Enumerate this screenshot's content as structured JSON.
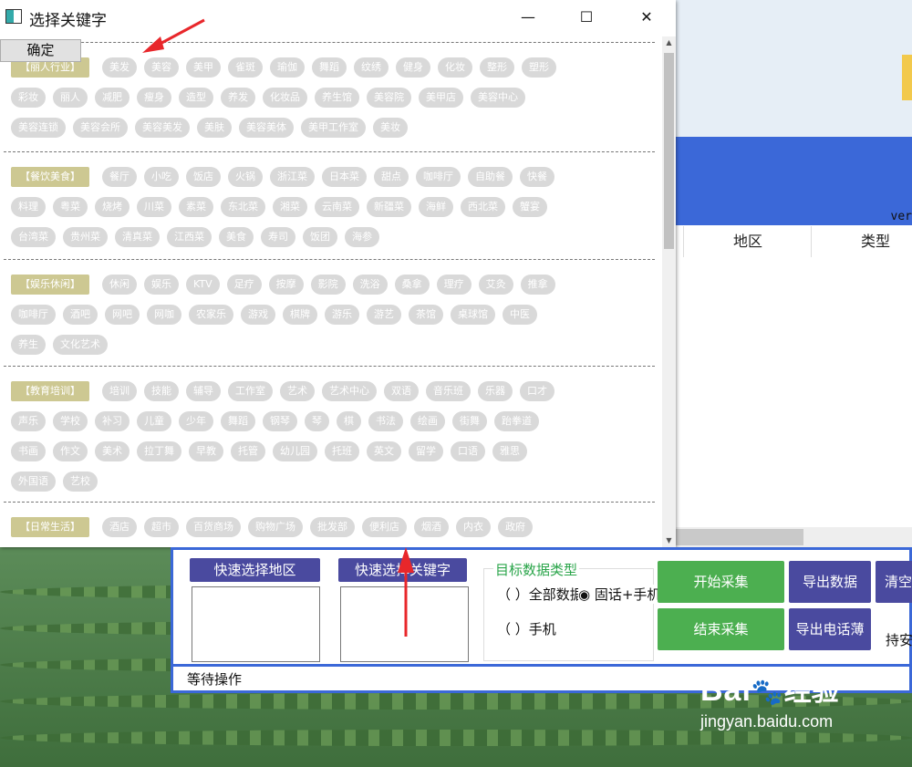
{
  "dialog": {
    "title": "选择关键字",
    "ok_label": "确定",
    "min_glyph": "—",
    "max_glyph": "☐",
    "close_glyph": "✕",
    "sections": [
      {
        "category": "【丽人行业】",
        "rows": [
          [
            "美发",
            "美容",
            "美甲",
            "雀斑",
            "瑜伽",
            "舞蹈",
            "纹绣",
            "健身",
            "化妆",
            "整形",
            "塑形"
          ],
          [
            "彩妆",
            "丽人",
            "减肥",
            "瘦身",
            "造型",
            "养发",
            "化妆品",
            "养生馆",
            "美容院",
            "美甲店",
            "美容中心"
          ],
          [
            "美容连锁",
            "美容会所",
            "美容美发",
            "美肤",
            "美容美体",
            "美甲工作室",
            "美妆"
          ]
        ]
      },
      {
        "category": "【餐饮美食】",
        "rows": [
          [
            "餐厅",
            "小吃",
            "饭店",
            "火锅",
            "浙江菜",
            "日本菜",
            "甜点",
            "咖啡厅",
            "自助餐",
            "快餐"
          ],
          [
            "料理",
            "粤菜",
            "烧烤",
            "川菜",
            "素菜",
            "东北菜",
            "湘菜",
            "云南菜",
            "新疆菜",
            "海鲜",
            "西北菜",
            "蟹宴"
          ],
          [
            "台湾菜",
            "贵州菜",
            "清真菜",
            "江西菜",
            "美食",
            "寿司",
            "饭团",
            "海参"
          ]
        ]
      },
      {
        "category": "【娱乐休闲】",
        "rows": [
          [
            "休闲",
            "娱乐",
            "KTV",
            "足疗",
            "按摩",
            "影院",
            "洗浴",
            "桑拿",
            "理疗",
            "艾灸",
            "推拿"
          ],
          [
            "咖啡厅",
            "酒吧",
            "网吧",
            "网咖",
            "农家乐",
            "游戏",
            "棋牌",
            "游乐",
            "游艺",
            "茶馆",
            "桌球馆",
            "中医"
          ],
          [
            "养生",
            "文化艺术"
          ]
        ]
      },
      {
        "category": "【教育培训】",
        "rows": [
          [
            "培训",
            "技能",
            "辅导",
            "工作室",
            "艺术",
            "艺术中心",
            "双语",
            "音乐班",
            "乐器",
            "口才"
          ],
          [
            "声乐",
            "学校",
            "补习",
            "儿童",
            "少年",
            "舞蹈",
            "钢琴",
            "琴",
            "棋",
            "书法",
            "绘画",
            "街舞",
            "跆拳道"
          ],
          [
            "书画",
            "作文",
            "美术",
            "拉丁舞",
            "早教",
            "托管",
            "幼儿园",
            "托班",
            "英文",
            "留学",
            "口语",
            "雅思"
          ],
          [
            "外国语",
            "艺校"
          ]
        ]
      },
      {
        "category": "【日常生活】",
        "rows": [
          [
            "酒店",
            "超市",
            "百货商场",
            "购物广场",
            "批发部",
            "便利店",
            "烟酒",
            "内衣",
            "政府"
          ]
        ]
      }
    ],
    "scroll_up": "▲",
    "scroll_down": "▼"
  },
  "background_app": {
    "version_text": "ver",
    "columns": [
      "地区",
      "类型"
    ]
  },
  "main_panel": {
    "quick_region_label": "快速选择地区",
    "quick_keyword_label": "快速选择关键字",
    "target_type_title": "目标数据类型",
    "radio_all": "（ ）全部数据",
    "radio_fixed": "◉ 固话+手机",
    "radio_mobile": "（ ）手机",
    "start_label": "开始采集",
    "end_label": "结束采集",
    "export_data_label": "导出数据",
    "export_phone_label": "导出电话薄",
    "clear_label": "清空",
    "side_text": "持安",
    "status_text": "等待操作"
  },
  "watermark": {
    "logo_text": "Bai",
    "logo_text2": "经验",
    "url": "jingyan.baidu.com"
  },
  "colors": {
    "accent_blue": "#3b68d8",
    "button_purple": "#4a4a9f",
    "button_green": "#4caf50",
    "category_tag": "#cdc892",
    "keyword_tag": "#d9d9d9",
    "arrow_red": "#e8272b"
  }
}
